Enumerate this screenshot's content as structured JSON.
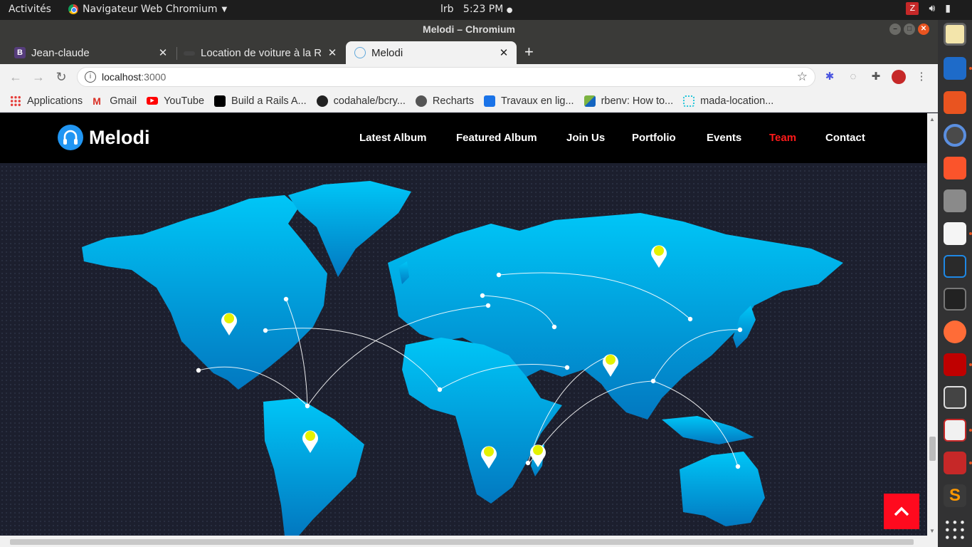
{
  "system": {
    "activities": "Activités",
    "app_name": "Navigateur Web Chromium",
    "user": "lrb",
    "time": "5:23 PM"
  },
  "window": {
    "title": "Melodi – Chromium"
  },
  "tabs": [
    {
      "label": "Jean-claude",
      "icon": "bootstrap-icon",
      "color": "#563d7c"
    },
    {
      "label": "Location de voiture à la Ré",
      "icon": "car-icon",
      "color": "#444444"
    },
    {
      "label": "Melodi",
      "icon": "react-icon",
      "color": "#61dafb"
    }
  ],
  "address": {
    "host": "localhost",
    "port": ":3000"
  },
  "bookmarks": [
    {
      "label": "Applications",
      "icon": "apps-grid-icon",
      "color": "#e53935"
    },
    {
      "label": "Gmail",
      "icon": "gmail-icon",
      "color": "#d93025"
    },
    {
      "label": "YouTube",
      "icon": "youtube-icon",
      "color": "#ff0000"
    },
    {
      "label": "Build a Rails A...",
      "icon": "dev-icon",
      "color": "#000000"
    },
    {
      "label": "codahale/bcry...",
      "icon": "github-icon",
      "color": "#222222"
    },
    {
      "label": "Recharts",
      "icon": "globe-icon",
      "color": "#555555"
    },
    {
      "label": "Travaux en lig...",
      "icon": "travaux-icon",
      "color": "#1a73e8"
    },
    {
      "label": "rbenv: How to...",
      "icon": "rbenv-icon",
      "color": "#7cb342"
    },
    {
      "label": "mada-location...",
      "icon": "dotted-square-icon",
      "color": "#26c6da"
    }
  ],
  "site": {
    "brand": "Melodi",
    "nav": [
      {
        "label": "Latest Album",
        "active": false
      },
      {
        "label": "Featured Album",
        "active": false
      },
      {
        "label": "Join Us",
        "active": false
      },
      {
        "label": "Portfolio",
        "active": false
      },
      {
        "label": "Events",
        "active": false
      },
      {
        "label": "Team",
        "active": true
      },
      {
        "label": "Contact",
        "active": false
      }
    ],
    "accent": "#ff0a1e",
    "map_color_top": "#00c3f5",
    "map_color_bottom": "#0277bd"
  },
  "dock": [
    "rhythmbox-icon",
    "libreoffice-writer-icon",
    "software-center-icon",
    "chromium-icon",
    "brave-icon",
    "files-icon",
    "text-editor-icon",
    "vscode-icon",
    "terminal-icon",
    "postman-icon",
    "filezilla-icon",
    "video-editor-icon",
    "screenshot-icon",
    "rubymine-icon",
    "sublime-icon",
    "show-apps-icon"
  ]
}
